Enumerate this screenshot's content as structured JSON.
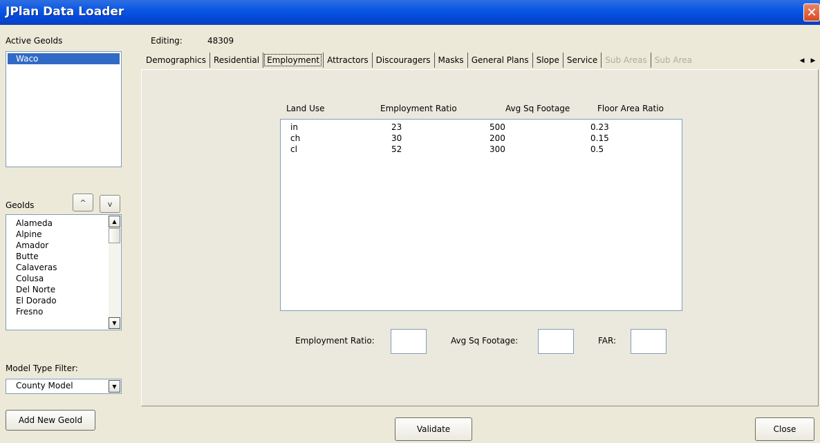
{
  "window": {
    "title": "JPlan Data Loader",
    "close_glyph": "✕"
  },
  "left_panel": {
    "active_geoids_label": "Active GeoIds",
    "active_geoids": [
      {
        "label": "Waco",
        "selected": true
      }
    ],
    "move_up_glyph": "^",
    "move_down_glyph": "v",
    "geoids_label": "GeoIds",
    "geoids": [
      "Alameda",
      "Alpine",
      "Amador",
      "Butte",
      "Calaveras",
      "Colusa",
      "Del Norte",
      "El Dorado",
      "Fresno"
    ],
    "model_type_filter_label": "Model Type Filter:",
    "model_type_value": "County Model",
    "add_button": "Add New GeoId"
  },
  "editing": {
    "label": "Editing:",
    "value": "48309"
  },
  "tabs": [
    {
      "label": "Demographics",
      "state": "normal"
    },
    {
      "label": "Residential",
      "state": "normal"
    },
    {
      "label": "Employment",
      "state": "active"
    },
    {
      "label": "Attractors",
      "state": "normal"
    },
    {
      "label": "Discouragers",
      "state": "normal"
    },
    {
      "label": "Masks",
      "state": "normal"
    },
    {
      "label": "General Plans",
      "state": "normal"
    },
    {
      "label": "Slope",
      "state": "normal"
    },
    {
      "label": "Service",
      "state": "normal"
    },
    {
      "label": "Sub Areas",
      "state": "disabled"
    },
    {
      "label": "Sub Area",
      "state": "disabled"
    }
  ],
  "tab_scroll": {
    "left": "◀",
    "right": "▶"
  },
  "employment": {
    "columns": [
      "Land Use",
      "Employment Ratio",
      "Avg Sq Footage",
      "Floor Area Ratio"
    ],
    "rows": [
      [
        "in",
        "23",
        "500",
        "0.23"
      ],
      [
        "ch",
        "30",
        "200",
        "0.15"
      ],
      [
        "cl",
        "52",
        "300",
        "0.5"
      ]
    ],
    "fields": {
      "employment_ratio_label": "Employment Ratio:",
      "employment_ratio_value": "",
      "avg_sq_footage_label": "Avg Sq Footage:",
      "avg_sq_footage_value": "",
      "far_label": "FAR:",
      "far_value": ""
    }
  },
  "footer": {
    "validate": "Validate",
    "close": "Close"
  }
}
